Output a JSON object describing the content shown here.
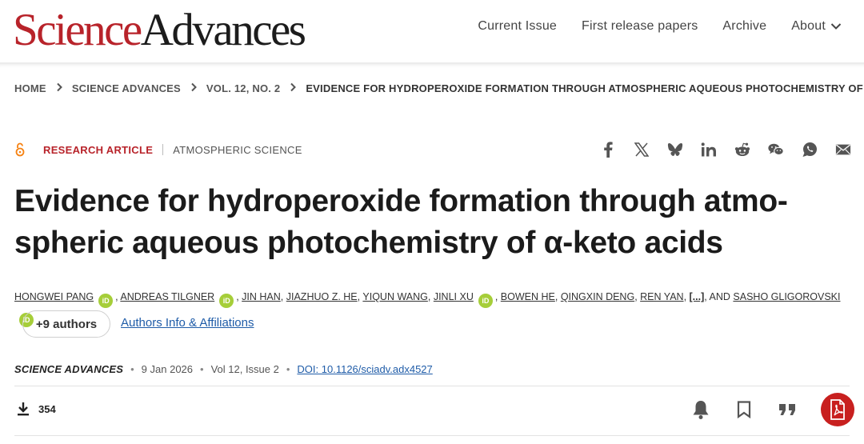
{
  "header": {
    "logo": {
      "part1": "Science",
      "part2": "Advances"
    },
    "nav": [
      "Current Issue",
      "First release papers",
      "Archive",
      "About"
    ]
  },
  "breadcrumb": [
    "HOME",
    "SCIENCE ADVANCES",
    "VOL. 12, NO. 2",
    "EVIDENCE FOR HYDROPEROXIDE FORMATION THROUGH ATMOSPHERIC AQUEOUS PHOTOCHEMISTRY OF A-..."
  ],
  "article": {
    "type": "RESEARCH ARTICLE",
    "subject": "ATMOSPHERIC SCIENCE",
    "title_line1": "Evidence for hydroperoxide formation through atmo-",
    "title_line2": "spheric aqueous photochemistry of α-keto acids",
    "authors": [
      {
        "name": "HONGWEI PANG",
        "orcid": true
      },
      {
        "name": "ANDREAS TILGNER",
        "orcid": true
      },
      {
        "name": "JIN HAN",
        "orcid": false
      },
      {
        "name": "JIAZHUO Z. HE",
        "orcid": false
      },
      {
        "name": "YIQUN WANG",
        "orcid": false
      },
      {
        "name": "JINLI XU",
        "orcid": true
      },
      {
        "name": "BOWEN HE",
        "orcid": false
      },
      {
        "name": "QINGXIN DENG",
        "orcid": false
      },
      {
        "name": "REN YAN",
        "orcid": false
      },
      {
        "name": "SASHO GLIGOROVSKI",
        "orcid": true
      }
    ],
    "ellipsis": "[...]",
    "and_text": ", AND",
    "more_authors": "+9 authors",
    "affiliations_link": "Authors Info & Affiliations",
    "journal": "SCIENCE ADVANCES",
    "date": "9 Jan 2026",
    "volume": "Vol 12, Issue 2",
    "doi": "DOI: 10.1126/sciadv.adx4527",
    "downloads": "354"
  },
  "share_icons": [
    "facebook-icon",
    "x-icon",
    "bluesky-icon",
    "linkedin-icon",
    "reddit-icon",
    "wechat-icon",
    "whatsapp-icon",
    "email-icon"
  ],
  "tool_icons": [
    "bell-icon",
    "bookmark-icon",
    "quote-icon",
    "pdf-icon"
  ],
  "colors": {
    "brand_red": "#b8232a",
    "link_blue": "#1f5ca8",
    "orcid_green": "#a6ce39",
    "pdf_red": "#c8201f",
    "open_access_orange": "#f68212"
  }
}
